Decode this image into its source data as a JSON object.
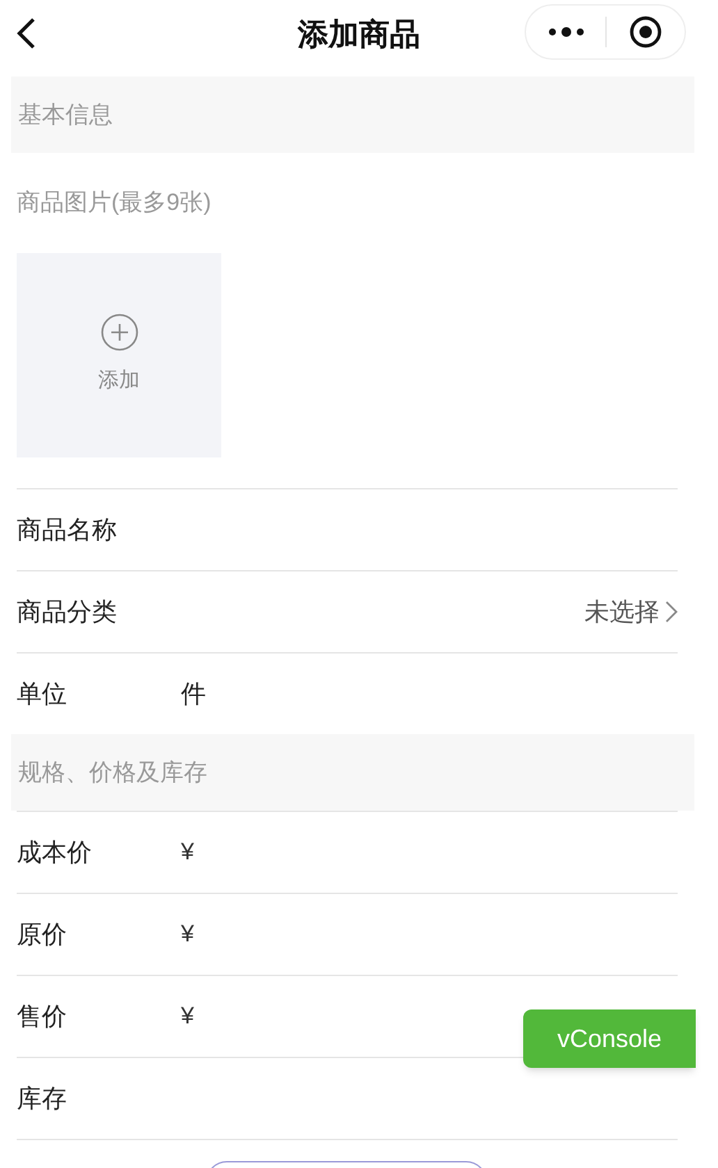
{
  "nav": {
    "title": "添加商品"
  },
  "sections": [
    {
      "title": "基本信息",
      "photos": {
        "label": "商品图片(最多9张)",
        "add_label": "添加"
      },
      "rows": [
        {
          "kind": "input",
          "label": "商品名称"
        },
        {
          "kind": "select",
          "label": "商品分类",
          "value": "未选择"
        },
        {
          "kind": "input",
          "label": "单位",
          "value": "件"
        }
      ]
    },
    {
      "title": "规格、价格及库存",
      "rows": [
        {
          "kind": "price",
          "label": "成本价",
          "prefix": "¥"
        },
        {
          "kind": "price",
          "label": "原价",
          "prefix": "¥"
        },
        {
          "kind": "price",
          "label": "售价",
          "prefix": "¥"
        },
        {
          "kind": "input",
          "label": "库存"
        }
      ]
    }
  ],
  "vconsole": {
    "label": "vConsole"
  }
}
